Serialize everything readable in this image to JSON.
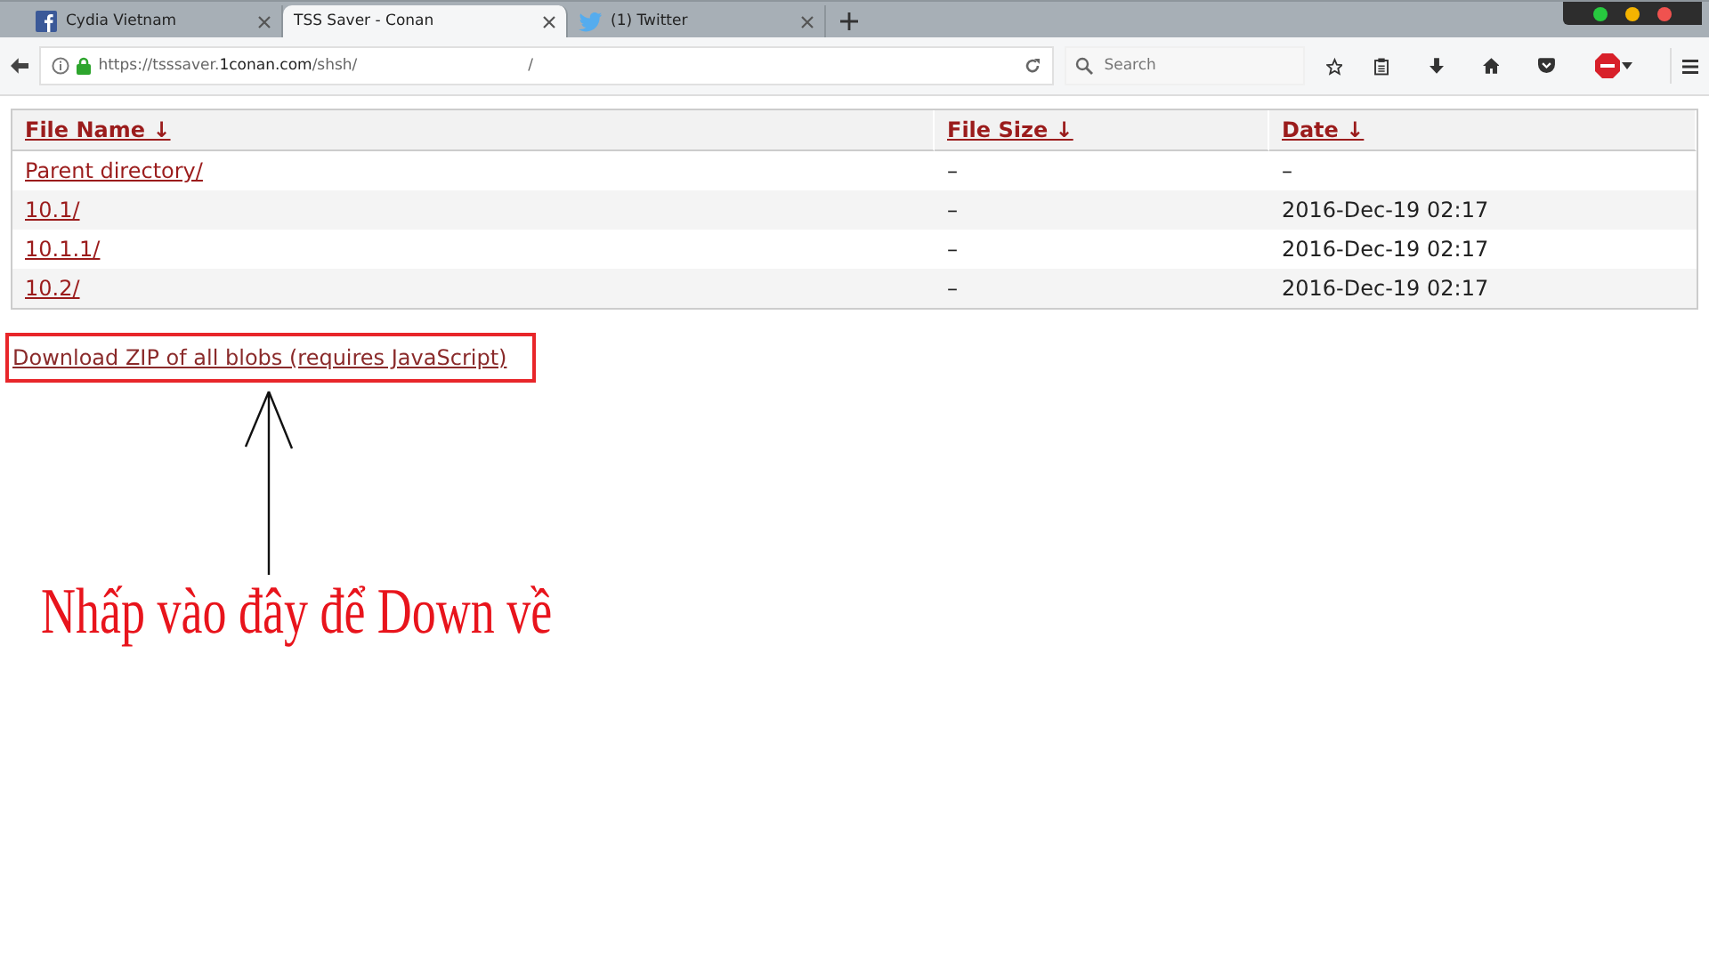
{
  "tabs": [
    {
      "label": "Cydia Vietnam",
      "selected": false
    },
    {
      "label": "TSS Saver - Conan",
      "selected": true
    },
    {
      "label": "(1) Twitter",
      "selected": false
    }
  ],
  "address_bar": {
    "url_start": "https://tsssaver.",
    "url_domain": "1conan.com",
    "url_path": "/shsh/",
    "url_end": "/"
  },
  "search": {
    "placeholder": "Search"
  },
  "table": {
    "columns": [
      "File Name ↓",
      "File Size ↓",
      "Date ↓"
    ],
    "rows": [
      [
        "Parent directory/",
        "–",
        "–"
      ],
      [
        "10.1/",
        "–",
        "2016-Dec-19 02:17"
      ],
      [
        "10.1.1/",
        "–",
        "2016-Dec-19 02:17"
      ],
      [
        "10.2/",
        "–",
        "2016-Dec-19 02:17"
      ]
    ]
  },
  "download_link": "Download ZIP of all blobs (requires JavaScript)",
  "annotation": "Nhấp vào đây để Down về"
}
